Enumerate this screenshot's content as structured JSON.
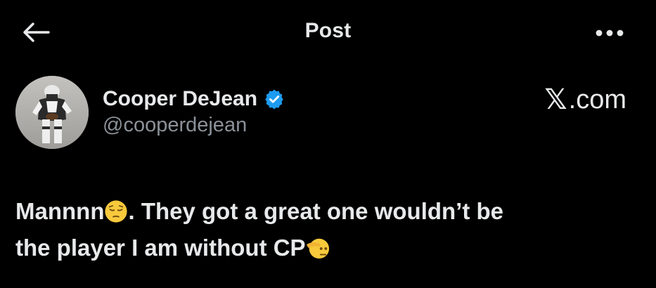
{
  "header": {
    "title": "Post",
    "back_icon": "arrow-left-icon",
    "more_icon": "more-horizontal-icon"
  },
  "author": {
    "name": "Cooper DeJean",
    "handle": "@cooperdejean",
    "verified": true,
    "verified_color": "#1d9bf0"
  },
  "watermark": {
    "logo": "𝕏",
    "text": ".com"
  },
  "tweet": {
    "line1_a": "Mannnn",
    "line1_b": ". They got a great one wouldn’t be",
    "line2_a": "the player I am without CP",
    "emoji_1": "pensive-face-icon",
    "emoji_2": "saluting-face-icon"
  },
  "colors": {
    "background": "#000000",
    "text_primary": "#e7e9ea",
    "text_secondary": "#8b9198",
    "accent": "#1d9bf0"
  }
}
